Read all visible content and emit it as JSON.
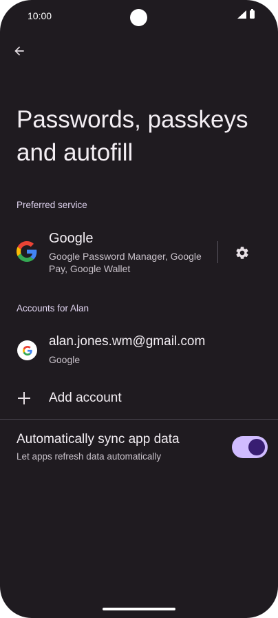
{
  "status_bar": {
    "time": "10:00"
  },
  "header": {
    "back_icon": "arrow-back-icon",
    "title": "Passwords, passkeys and autofill"
  },
  "preferred_service": {
    "section_label": "Preferred service",
    "name": "Google",
    "description": "Google Password Manager, Google Pay, Google Wallet",
    "logo_icon": "google-g-icon",
    "settings_icon": "gear-icon"
  },
  "accounts": {
    "section_label": "Accounts for Alan",
    "items": [
      {
        "email": "alan.jones.wm@gmail.com",
        "provider": "Google",
        "icon": "google-g-icon"
      }
    ],
    "add_label": "Add account",
    "add_icon": "plus-icon"
  },
  "sync": {
    "title": "Automatically sync app data",
    "subtitle": "Let apps refresh data automatically",
    "enabled": true
  },
  "colors": {
    "background": "#1f1b20",
    "accent": "#d0bcff",
    "toggle_knob": "#381e72",
    "section_header": "#e0d4f0"
  }
}
